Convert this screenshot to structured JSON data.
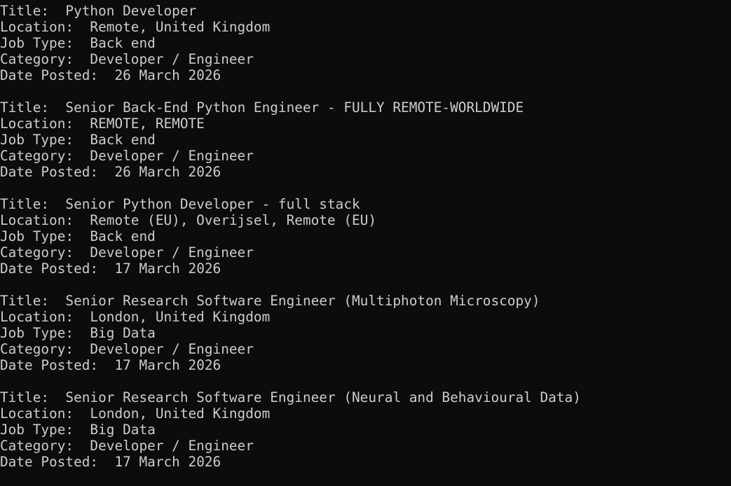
{
  "terminal": {
    "jobs": [
      {
        "title_label": "Title:  ",
        "title": "Python Developer",
        "location_label": "Location:  ",
        "location": "Remote, United Kingdom",
        "job_type_label": "Job Type:  ",
        "job_type": "Back end",
        "category_label": "Category:  ",
        "category": "Developer / Engineer",
        "date_label": "Date Posted:  ",
        "date": "26 March 2026"
      },
      {
        "title_label": "Title:  ",
        "title": "Senior Back-End Python Engineer - FULLY REMOTE-WORLDWIDE",
        "location_label": "Location:  ",
        "location": "REMOTE, REMOTE",
        "job_type_label": "Job Type:  ",
        "job_type": "Back end",
        "category_label": "Category:  ",
        "category": "Developer / Engineer",
        "date_label": "Date Posted:  ",
        "date": "26 March 2026"
      },
      {
        "title_label": "Title:  ",
        "title": "Senior Python Developer - full stack",
        "location_label": "Location:  ",
        "location": "Remote (EU), Overijsel, Remote (EU)",
        "job_type_label": "Job Type:  ",
        "job_type": "Back end",
        "category_label": "Category:  ",
        "category": "Developer / Engineer",
        "date_label": "Date Posted:  ",
        "date": "17 March 2026"
      },
      {
        "title_label": "Title:  ",
        "title": "Senior Research Software Engineer (Multiphoton Microscopy)",
        "location_label": "Location:  ",
        "location": "London, United Kingdom",
        "job_type_label": "Job Type:  ",
        "job_type": "Big Data",
        "category_label": "Category:  ",
        "category": "Developer / Engineer",
        "date_label": "Date Posted:  ",
        "date": "17 March 2026"
      },
      {
        "title_label": "Title:  ",
        "title": "Senior Research Software Engineer (Neural and Behavioural Data)",
        "location_label": "Location:  ",
        "location": "London, United Kingdom",
        "job_type_label": "Job Type:  ",
        "job_type": "Big Data",
        "category_label": "Category:  ",
        "category": "Developer / Engineer",
        "date_label": "Date Posted:  ",
        "date": "17 March 2026"
      }
    ]
  },
  "colors": {
    "background": "#0c0c0c",
    "text": "#cccccc"
  }
}
